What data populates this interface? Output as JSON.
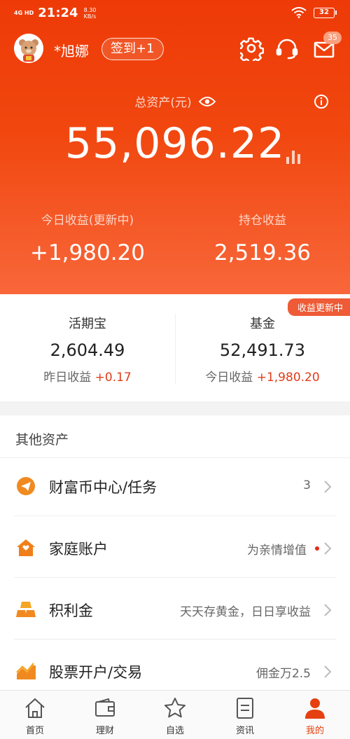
{
  "status_bar": {
    "network": "4G HD",
    "time": "21:24",
    "speed_value": "8.30",
    "speed_unit": "KB/s",
    "battery": "32"
  },
  "header": {
    "username": "*旭娜",
    "signin_label": "签到+1",
    "mail_badge": "35"
  },
  "assets": {
    "total_label": "总资产(元)",
    "total_value": "55,096.22",
    "today_label": "今日收益(更新中)",
    "today_value": "+1,980.20",
    "holding_label": "持仓收益",
    "holding_value": "2,519.36"
  },
  "cards": {
    "update_tag": "收益更新中",
    "left": {
      "title": "活期宝",
      "value": "2,604.49",
      "yest_label": "昨日收益",
      "yest_value": "+0.17"
    },
    "right": {
      "title": "基金",
      "value": "52,491.73",
      "yest_label": "今日收益",
      "yest_value": "+1,980.20"
    }
  },
  "other_assets": {
    "title": "其他资产",
    "items": [
      {
        "name": "财富币中心/任务",
        "right": "3",
        "icon": "paper-plane-icon"
      },
      {
        "name": "家庭账户",
        "right": "为亲情增值",
        "icon": "house-icon"
      },
      {
        "name": "积利金",
        "right": "天天存黄金，日日享收益",
        "icon": "gold-bar-icon"
      },
      {
        "name": "股票开户/交易",
        "right": "佣金万2.5",
        "icon": "stock-chart-icon"
      }
    ]
  },
  "tabs": [
    {
      "label": "首页",
      "icon": "home-icon"
    },
    {
      "label": "理财",
      "icon": "wallet-icon"
    },
    {
      "label": "自选",
      "icon": "star-icon"
    },
    {
      "label": "资讯",
      "icon": "news-icon"
    },
    {
      "label": "我的",
      "icon": "user-icon",
      "active": true
    }
  ],
  "colors": {
    "brand": "#ee3a07",
    "positive": "#e23b1a",
    "active_tab": "#e5400f"
  }
}
